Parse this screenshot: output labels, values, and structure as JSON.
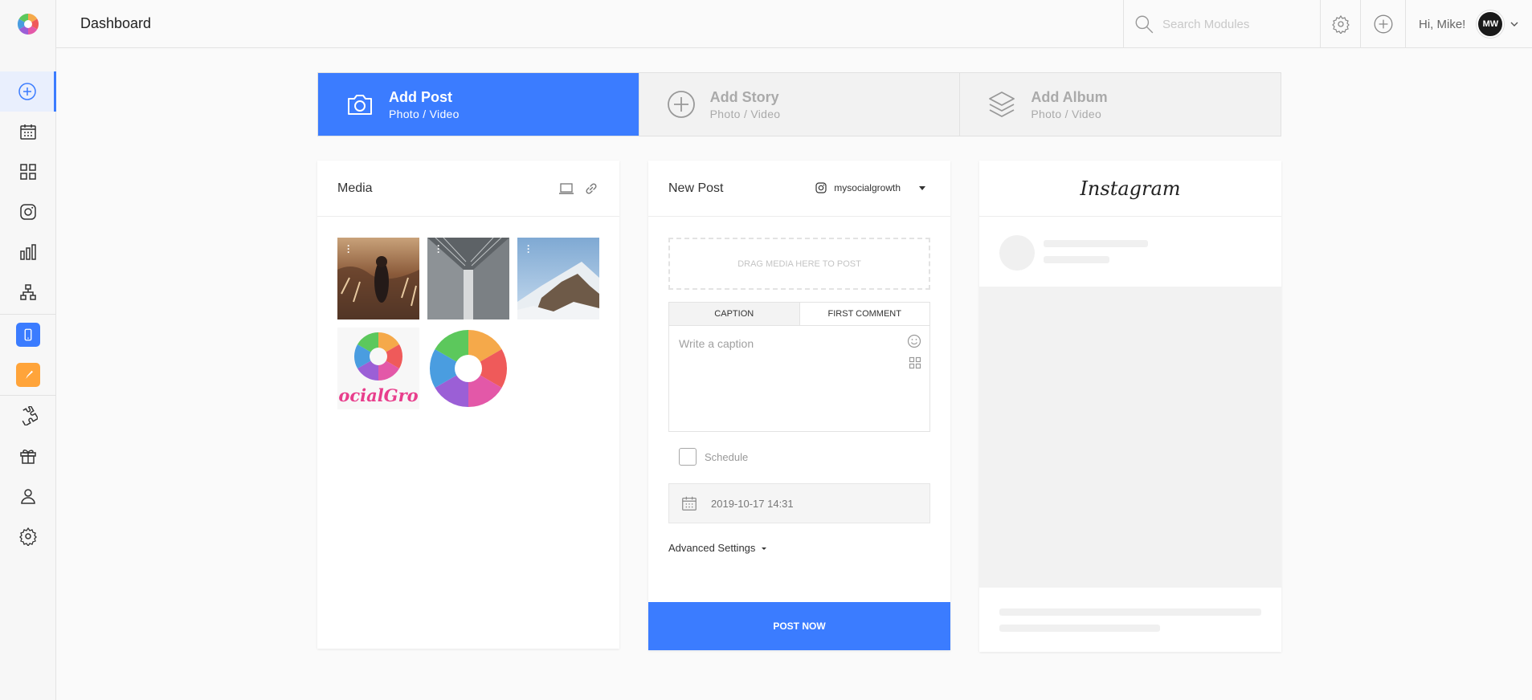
{
  "app": {
    "title": "Dashboard"
  },
  "sidebar": {
    "items": [
      {
        "icon": "plus-circle-icon",
        "active": true
      },
      {
        "icon": "calendar-icon"
      },
      {
        "icon": "grid-icon"
      },
      {
        "icon": "instagram-icon"
      },
      {
        "icon": "bar-chart-icon"
      },
      {
        "icon": "sitemap-icon"
      },
      {
        "icon": "mobile-app-icon",
        "color": "#3b7cff"
      },
      {
        "icon": "brush-icon",
        "color": "#ffa43a"
      },
      {
        "icon": "puzzle-icon"
      },
      {
        "icon": "gift-icon"
      },
      {
        "icon": "users-icon"
      },
      {
        "icon": "settings-icon"
      }
    ]
  },
  "header": {
    "search_placeholder": "Search Modules",
    "greeting": "Hi, Mike!",
    "avatar_initials": "MW"
  },
  "post_types": [
    {
      "title": "Add Post",
      "subtitle": "Photo / Video",
      "active": true
    },
    {
      "title": "Add Story",
      "subtitle": "Photo / Video"
    },
    {
      "title": "Add Album",
      "subtitle": "Photo / Video"
    }
  ],
  "media": {
    "title": "Media",
    "items": [
      "photo-wheat-field",
      "photo-architecture-corridor",
      "photo-snowy-mountain",
      "logo-socialgrowth",
      "logo-aperture"
    ],
    "logo_text": "ocialGro"
  },
  "new_post": {
    "title": "New Post",
    "account": "mysocialgrowth",
    "drop_text": "Drag media here to post",
    "tabs": [
      "Caption",
      "First Comment"
    ],
    "caption_placeholder": "Write a caption",
    "schedule_label": "Schedule",
    "date_value": "2019-10-17 14:31",
    "advanced_label": "Advanced Settings",
    "post_button": "Post Now"
  },
  "preview": {
    "title": "Instagram"
  },
  "colors": {
    "accent": "#3b7cff",
    "brush_badge": "#ffa43a"
  }
}
